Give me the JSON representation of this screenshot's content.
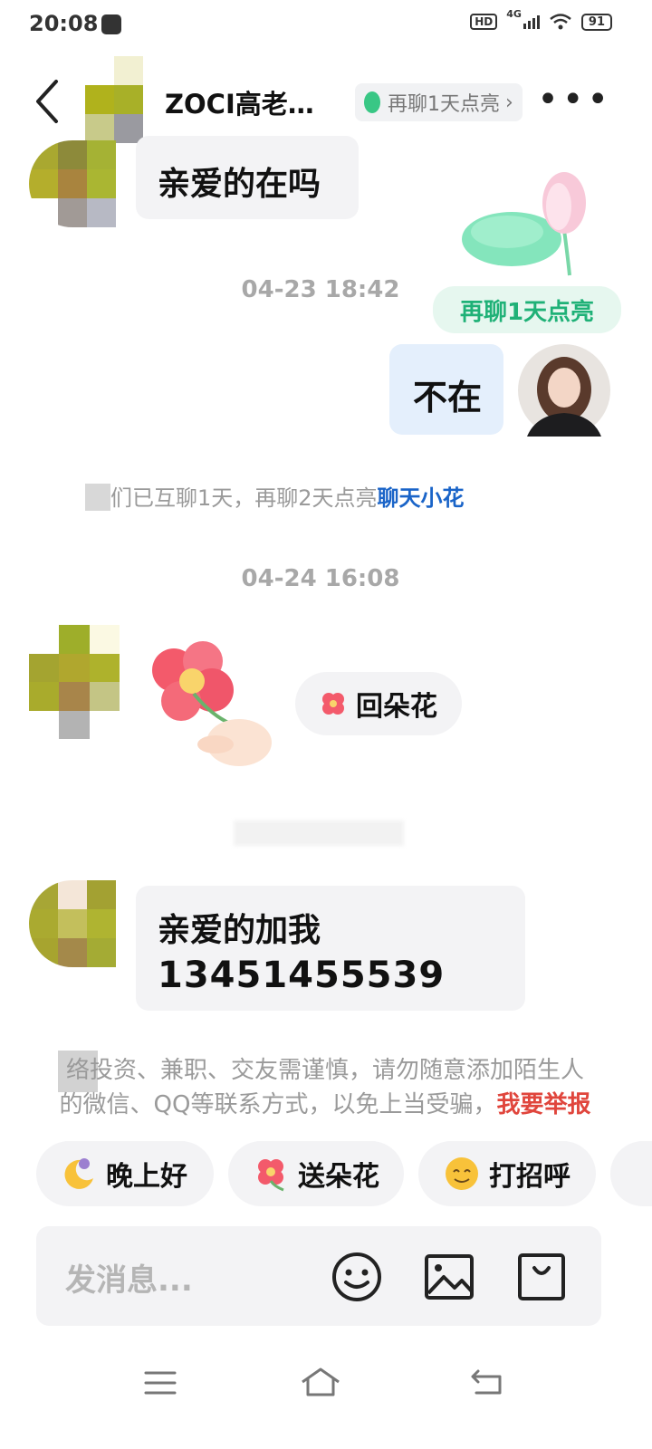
{
  "status_bar": {
    "time": "20:08",
    "hd_label": "HD",
    "network_label": "4G",
    "battery_level": "91"
  },
  "header": {
    "title": "ZOCI高老…",
    "streak_label": "再聊1天点亮",
    "streak_chevron": "›"
  },
  "messages": {
    "m1_text": "亲爱的在吗",
    "time_1": "04-23 18:42",
    "lotus_badge": "再聊1天点亮",
    "m2_text": "不在",
    "system_prefix": "们已互聊1天，再聊2天点亮",
    "system_link": "聊天小花",
    "time_2": "04-24 16:08",
    "reply_flower_label": "回朵花",
    "m3_line1": "亲爱的加我",
    "m3_line2": "13451455539",
    "warning_text": "络投资、兼职、交友需谨慎，请勿随意添加陌生人的微信、QQ等联系方式，以免上当受骗",
    "warning_link": "我要举报"
  },
  "quick_replies": [
    {
      "label": "晚上好",
      "icon": "sleeping-moon-icon"
    },
    {
      "label": "送朵花",
      "icon": "flower-icon"
    },
    {
      "label": "打招呼",
      "icon": "wave-emoji-icon"
    }
  ],
  "input": {
    "placeholder": "发消息..."
  },
  "colors": {
    "accent_green": "#1fb177",
    "link_blue": "#1a64c8",
    "bubble_self": "#e4effc",
    "bubble_other": "#f3f3f5"
  }
}
